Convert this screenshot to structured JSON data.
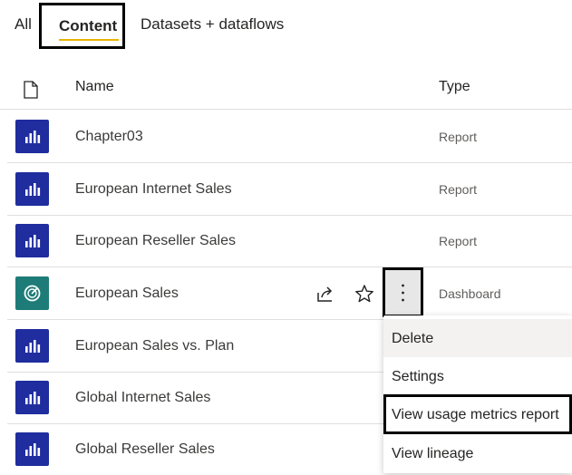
{
  "tabs": {
    "all": "All",
    "content": "Content",
    "datasets": "Datasets + dataflows"
  },
  "table": {
    "columns": {
      "icon": "file-icon",
      "name": "Name",
      "type": "Type"
    },
    "rows": [
      {
        "name": "Chapter03",
        "type": "Report",
        "icon": "report-bar-chart-icon"
      },
      {
        "name": "European Internet Sales",
        "type": "Report",
        "icon": "report-bar-chart-icon"
      },
      {
        "name": "European Reseller Sales",
        "type": "Report",
        "icon": "report-bar-chart-icon"
      },
      {
        "name": "European Sales",
        "type": "Dashboard",
        "icon": "dashboard-gauge-icon"
      },
      {
        "name": "European Sales vs. Plan",
        "type": "",
        "icon": "report-bar-chart-icon"
      },
      {
        "name": "Global Internet Sales",
        "type": "",
        "icon": "report-bar-chart-icon"
      },
      {
        "name": "Global Reseller Sales",
        "type": "",
        "icon": "report-bar-chart-icon"
      }
    ]
  },
  "row_actions": {
    "share": "share-icon",
    "favorite": "star-icon",
    "more": "more-options-icon"
  },
  "context_menu": {
    "items": [
      "Delete",
      "Settings",
      "View usage metrics report",
      "View lineage"
    ]
  },
  "colors": {
    "report_icon": "#1f2d9e",
    "dashboard_icon": "#1e7c78",
    "tab_underline": "#e8b400",
    "highlight_border": "#000000"
  }
}
